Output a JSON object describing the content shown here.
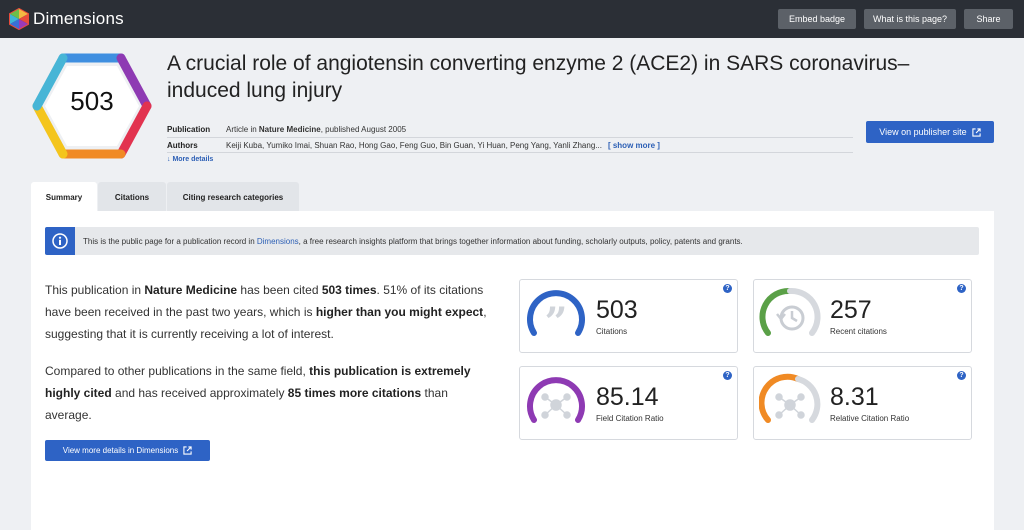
{
  "app": {
    "logo_text": "Dimensions",
    "buttons": {
      "embed": "Embed badge",
      "what": "What is this page?",
      "share": "Share"
    }
  },
  "badge": {
    "value": "503"
  },
  "publication": {
    "title_line1": "A crucial role of angiotensin converting enzyme 2 (ACE2) in SARS coronavirus–",
    "title_line2": "induced lung injury",
    "pub_label": "Publication",
    "pub_prefix": "Article in ",
    "journal": "Nature Medicine",
    "pub_suffix": ", published August 2005",
    "authors_label": "Authors",
    "authors": "Keiji Kuba, Yumiko Imai, Shuan Rao, Hong Gao, Feng Guo, Bin Guan, Yi Huan, Peng Yang, Yanli Zhang...",
    "show_more": "[ show more ]",
    "more_details": "More details",
    "publisher_button": "View on publisher site"
  },
  "tabs": [
    {
      "label": "Summary"
    },
    {
      "label": "Citations"
    },
    {
      "label": "Citing research categories"
    }
  ],
  "info": {
    "text_before": "This is the public page for a publication record in ",
    "link": "Dimensions",
    "text_after": ", a free research insights platform that brings together information about funding, scholarly outputs, policy, patents and grants."
  },
  "summary": {
    "p1_a": "This publication in ",
    "p1_journal": "Nature Medicine",
    "p1_b": " has been cited ",
    "p1_times": "503 times",
    "p1_c": ". 51% of its citations have been received in the past two years, which is ",
    "p1_expect": "higher than you might expect",
    "p1_d": ", suggesting that it is currently receiving a lot of interest.",
    "p2_a": "Compared to other publications in the same field, ",
    "p2_b": "this publication is extremely highly cited",
    "p2_c": " and has received approximately ",
    "p2_d": "85 times more citations",
    "p2_e": " than average.",
    "dims_button": "View more details in Dimensions"
  },
  "metrics": [
    {
      "value": "503",
      "label": "Citations",
      "color": "#2e63c5"
    },
    {
      "value": "257",
      "label": "Recent citations",
      "color": "#5aa047"
    },
    {
      "value": "85.14",
      "label": "Field Citation Ratio",
      "color": "#8e3ab3"
    },
    {
      "value": "8.31",
      "label": "Relative Citation Ratio",
      "color": "#f08a24"
    }
  ],
  "help_glyph": "?"
}
